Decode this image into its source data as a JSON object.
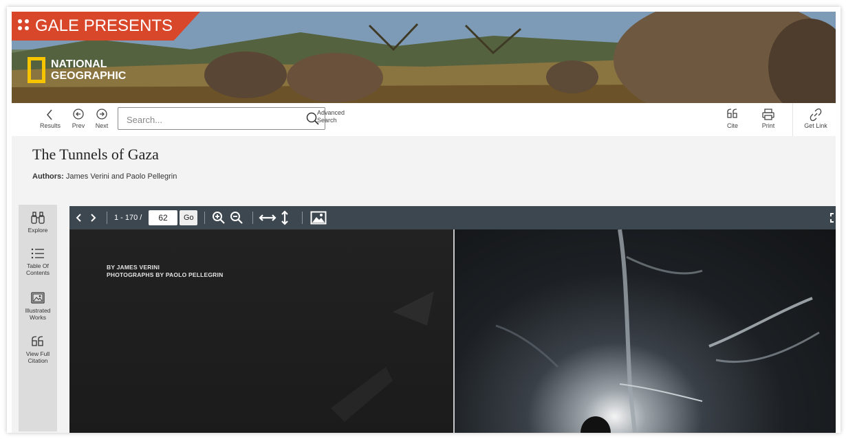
{
  "banner": {
    "presenter": "GALE PRESENTS",
    "brand_line1": "NATIONAL",
    "brand_line2": "GEOGRAPHIC"
  },
  "toolbar": {
    "results_label": "Results",
    "prev_label": "Prev",
    "next_label": "Next",
    "search_placeholder": "Search...",
    "advanced_line1": "Advanced",
    "advanced_line2": "Search",
    "cite_label": "Cite",
    "print_label": "Print",
    "get_link_label": "Get Link"
  },
  "document": {
    "title": "The Tunnels of Gaza",
    "authors_label": "Authors:",
    "authors": "James Verini and Paolo Pellegrin"
  },
  "side_panel": {
    "items": [
      {
        "line1": "Explore",
        "line2": ""
      },
      {
        "line1": "Table Of",
        "line2": "Contents"
      },
      {
        "line1": "Illustrated",
        "line2": "Works"
      },
      {
        "line1": "View Full",
        "line2": "Citation"
      }
    ]
  },
  "viewer": {
    "page_range": "1 - 170 /",
    "current_page": "62",
    "go_label": "Go",
    "byline_1": "BY JAMES VERINI",
    "byline_2": "PHOTOGRAPHS BY PAOLO PELLEGRIN"
  },
  "colors": {
    "gale_red": "#d9472b",
    "natgeo_yellow": "#f7c500",
    "viewer_bar": "#3d4750"
  }
}
